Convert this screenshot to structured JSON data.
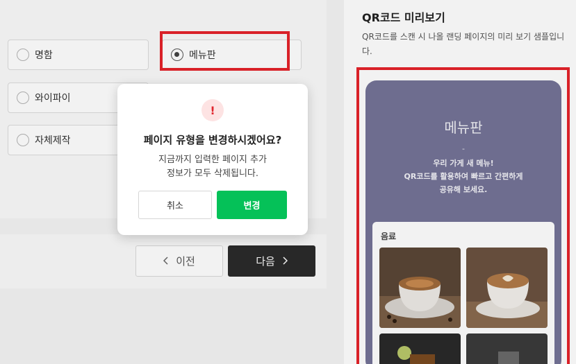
{
  "page_type_options": [
    {
      "label": "명함",
      "selected": false
    },
    {
      "label": "메뉴판",
      "selected": true
    },
    {
      "label": "와이파이",
      "selected": false
    },
    {
      "label": "자체제작",
      "selected": false
    }
  ],
  "nav": {
    "prev_label": "이전",
    "next_label": "다음"
  },
  "preview": {
    "title": "QR코드 미리보기",
    "description": "QR코드를 스캔 시 나올 랜딩 페이지의 미리 보기 샘플입니다.",
    "phone": {
      "heading": "메뉴판",
      "dash": "-",
      "line1": "우리 가게 새 메뉴!",
      "line2": "QR코드를 활용하여 빠르고 간편하게",
      "line3": "공유해 보세요.",
      "category": "음료"
    }
  },
  "modal": {
    "title": "페이지 유형을 변경하시겠어요?",
    "body_line1": "지금까지 입력한 페이지 추가",
    "body_line2": "정보가 모두 삭제됩니다.",
    "cancel_label": "취소",
    "confirm_label": "변경"
  },
  "colors": {
    "accent_green": "#05c158",
    "highlight_red": "#e5232b",
    "phone_bg": "#747397"
  }
}
